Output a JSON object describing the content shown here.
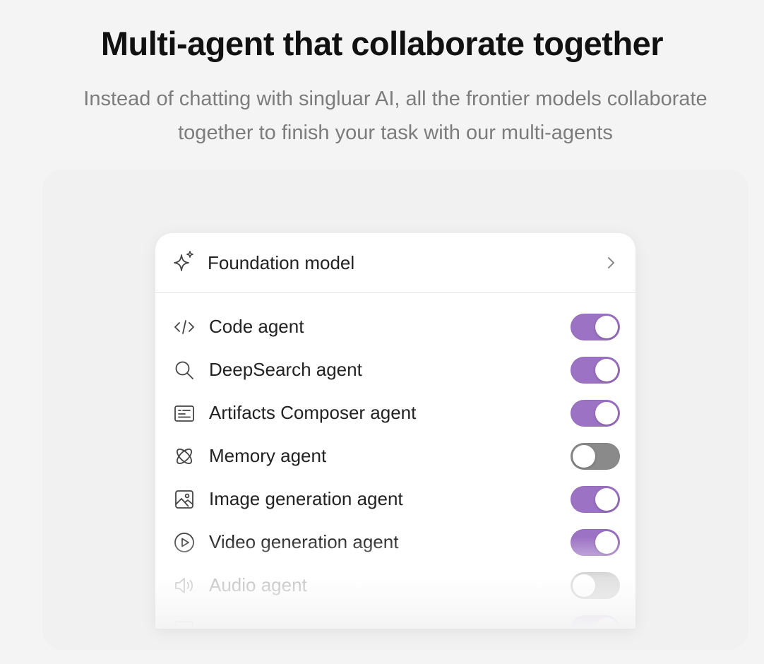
{
  "heading": "Multi-agent that collaborate together",
  "subtitle_line1": "Instead of chatting with singluar AI, all the frontier models collaborate",
  "subtitle_line2": "together to finish your task with our multi-agents",
  "colors": {
    "accent": "#9c72c4",
    "toggle_off": "#8a8a8a"
  },
  "panel": {
    "header": {
      "icon": "sparkle-icon",
      "label": "Foundation model"
    },
    "agents": [
      {
        "icon": "code-icon",
        "label": "Code agent",
        "enabled": true
      },
      {
        "icon": "search-icon",
        "label": "DeepSearch agent",
        "enabled": true
      },
      {
        "icon": "document-icon",
        "label": "Artifacts Composer agent",
        "enabled": true
      },
      {
        "icon": "atom-icon",
        "label": "Memory agent",
        "enabled": false
      },
      {
        "icon": "image-icon",
        "label": "Image generation agent",
        "enabled": true
      },
      {
        "icon": "play-icon",
        "label": "Video generation agent",
        "enabled": true
      },
      {
        "icon": "speaker-icon",
        "label": "Audio agent",
        "enabled": false
      }
    ]
  }
}
